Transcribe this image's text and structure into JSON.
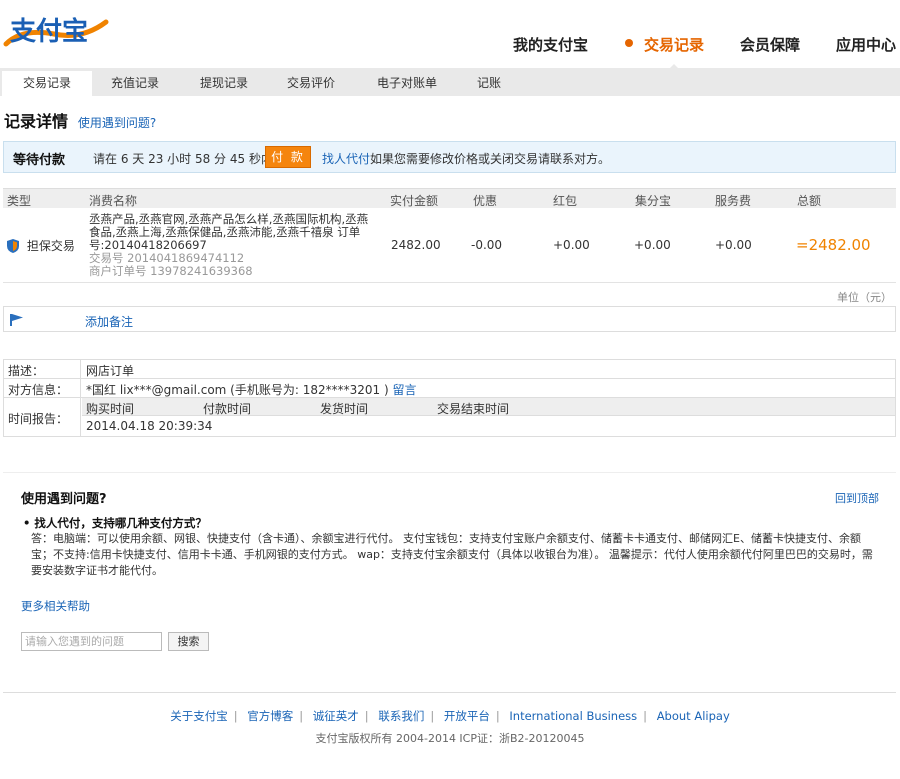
{
  "header": {
    "logo_text": "支付宝",
    "nav": [
      {
        "label": "我的支付宝"
      },
      {
        "label": "交易记录",
        "active": true
      },
      {
        "label": "会员保障"
      },
      {
        "label": "应用中心"
      }
    ]
  },
  "subnav": {
    "tabs": [
      {
        "label": "交易记录",
        "active": true
      },
      {
        "label": "充值记录"
      },
      {
        "label": "提现记录"
      },
      {
        "label": "交易评价"
      },
      {
        "label": "电子对账单"
      },
      {
        "label": "记账"
      }
    ]
  },
  "page": {
    "title": "记录详情",
    "help_link": "使用遇到问题?"
  },
  "status": {
    "state": "等待付款",
    "message": "请在 6 天 23 小时 58 分 45 秒内",
    "pay_button": "付 款",
    "agent_link": "找人代付",
    "note": "如果您需要修改价格或关闭交易请联系对方。"
  },
  "table": {
    "headers": {
      "type": "类型",
      "name": "消费名称",
      "amount": "实付金额",
      "discount": "优惠",
      "redpacket": "红包",
      "jifen": "集分宝",
      "fee": "服务费",
      "total": "总额"
    },
    "row": {
      "type": "担保交易",
      "name": "丞燕产品,丞燕官网,丞燕产品怎么样,丞燕国际机构,丞燕食品,丞燕上海,丞燕保健品,丞燕沛能,丞燕千禧泉 订单号:20140418206697",
      "trade_no": "交易号 2014041869474112",
      "merchant_no": "商户订单号 13978241639368",
      "amount": "2482.00",
      "discount": "-0.00",
      "redpacket": "+0.00",
      "jifen": "+0.00",
      "fee": "+0.00",
      "total": "=2482.00"
    },
    "unit": "单位（元）"
  },
  "remark": {
    "add_link": "添加备注"
  },
  "info": {
    "desc_label": "描述：",
    "desc_value": "网店订单",
    "party_label": "对方信息：",
    "party_value": "*国红 lix***@gmail.com (手机账号为: 182****3201 )",
    "party_link": "留言",
    "time_label": "时间报告：",
    "time_headers": [
      "购买时间",
      "付款时间",
      "发货时间",
      "交易结束时间"
    ],
    "buy_time": "2014.04.18 20:39:34"
  },
  "help": {
    "title": "使用遇到问题?",
    "back_top": "回到顶部",
    "question": "• 找人代付，支持哪几种支付方式？",
    "answer": "答：电脑端：可以使用余额、网银、快捷支付（含卡通）、余额宝进行代付。 支付宝钱包：支持支付宝账户余额支付、储蓄卡卡通支付、邮储网汇E、储蓄卡快捷支付、余额宝；不支持:信用卡快捷支付、信用卡卡通、手机网银的支付方式。 wap：支持支付宝余额支付（具体以收银台为准）。 温馨提示：代付人使用余额代付阿里巴巴的交易时，需要安装数字证书才能代付。",
    "more": "更多相关帮助",
    "search_placeholder": "请输入您遇到的问题",
    "search_button": "搜索"
  },
  "footer": {
    "links": [
      "关于支付宝",
      "官方博客",
      "诚征英才",
      "联系我们",
      "开放平台",
      "International Business",
      "About Alipay"
    ],
    "copyright": "支付宝版权所有 2004-2014 ICP证：浙B2-20120045"
  },
  "colors": {
    "accent": "#e56500",
    "link": "#1a64b6",
    "pay_button": "#f5850e",
    "status_bg": "#eaf4fc"
  }
}
